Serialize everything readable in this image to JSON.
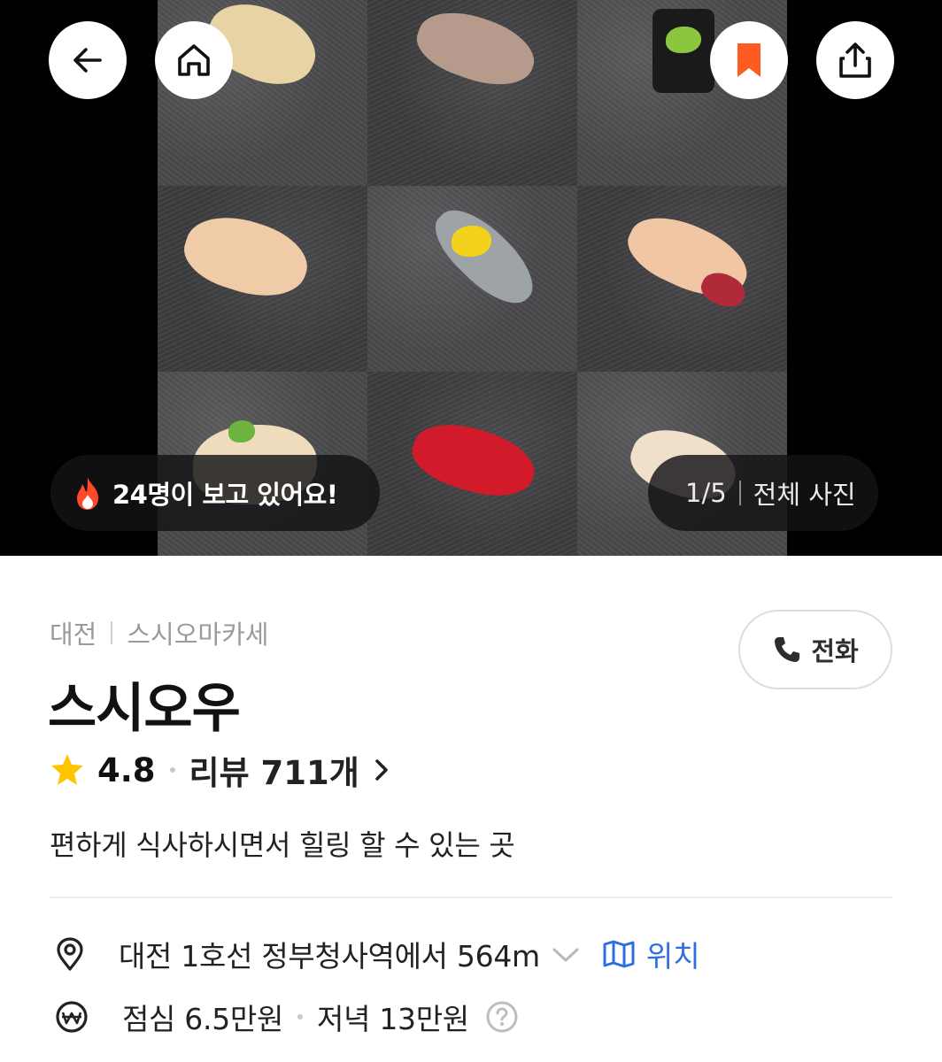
{
  "hero": {
    "viewers_text": "24명이 보고 있어요!",
    "photo_counter": "1/5",
    "all_photos_label": "전체 사진"
  },
  "top_actions": {
    "back_icon": "arrow-left-icon",
    "home_icon": "home-icon",
    "bookmark_icon": "bookmark-icon",
    "share_icon": "share-icon",
    "bookmark_color": "#ff5a1f"
  },
  "place": {
    "breadcrumb": [
      "대전",
      "스시오마카세"
    ],
    "name": "스시오우",
    "call_label": "전화",
    "rating": "4.8",
    "review_label": "리뷰 711개",
    "description": "편하게 식사하시면서 힐링 할 수 있는 곳",
    "location_text": "대전 1호선 정부청사역에서 564m",
    "location_link": "위치",
    "lunch_price": "점심 6.5만원",
    "dinner_price": "저녁 13만원"
  },
  "colors": {
    "accent_blue": "#2d6fe0",
    "star": "#ffc400",
    "fire": "#ff4a2a"
  }
}
